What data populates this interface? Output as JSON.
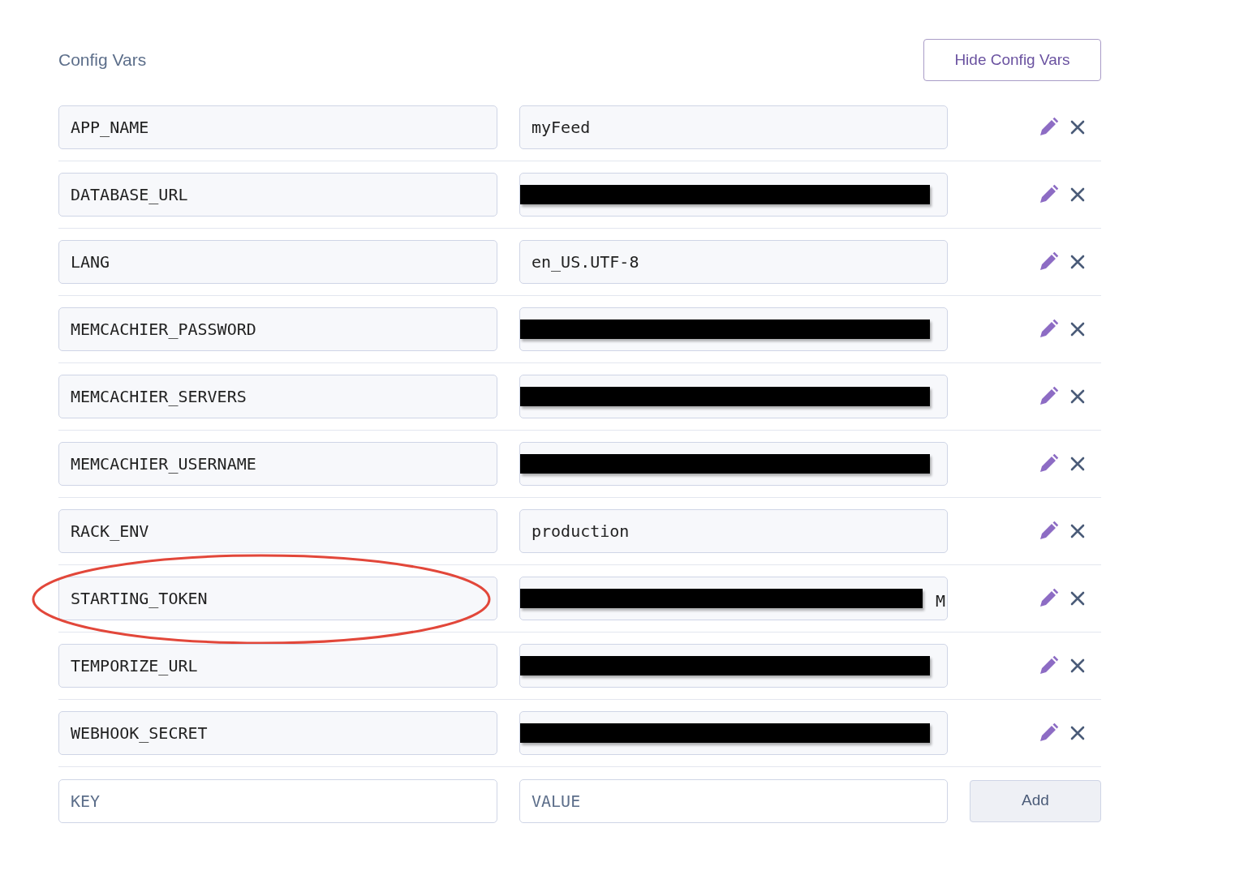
{
  "section": {
    "title": "Config Vars",
    "toggle_button": "Hide Config Vars"
  },
  "vars": [
    {
      "key": "APP_NAME",
      "value": "myFeed",
      "redacted": false,
      "highlighted": false
    },
    {
      "key": "DATABASE_URL",
      "redacted": true,
      "highlighted": false
    },
    {
      "key": "LANG",
      "value": "en_US.UTF-8",
      "redacted": false,
      "highlighted": false
    },
    {
      "key": "MEMCACHIER_PASSWORD",
      "redacted": true,
      "highlighted": false
    },
    {
      "key": "MEMCACHIER_SERVERS",
      "redacted": true,
      "highlighted": false
    },
    {
      "key": "MEMCACHIER_USERNAME",
      "redacted": true,
      "highlighted": false
    },
    {
      "key": "RACK_ENV",
      "value": "production",
      "redacted": false,
      "highlighted": false
    },
    {
      "key": "STARTING_TOKEN",
      "value": "M",
      "redacted": true,
      "highlighted": true
    },
    {
      "key": "TEMPORIZE_URL",
      "redacted": true,
      "highlighted": false
    },
    {
      "key": "WEBHOOK_SECRET",
      "redacted": true,
      "highlighted": false
    }
  ],
  "new_var": {
    "key_placeholder": "KEY",
    "value_placeholder": "VALUE",
    "add_button": "Add"
  }
}
